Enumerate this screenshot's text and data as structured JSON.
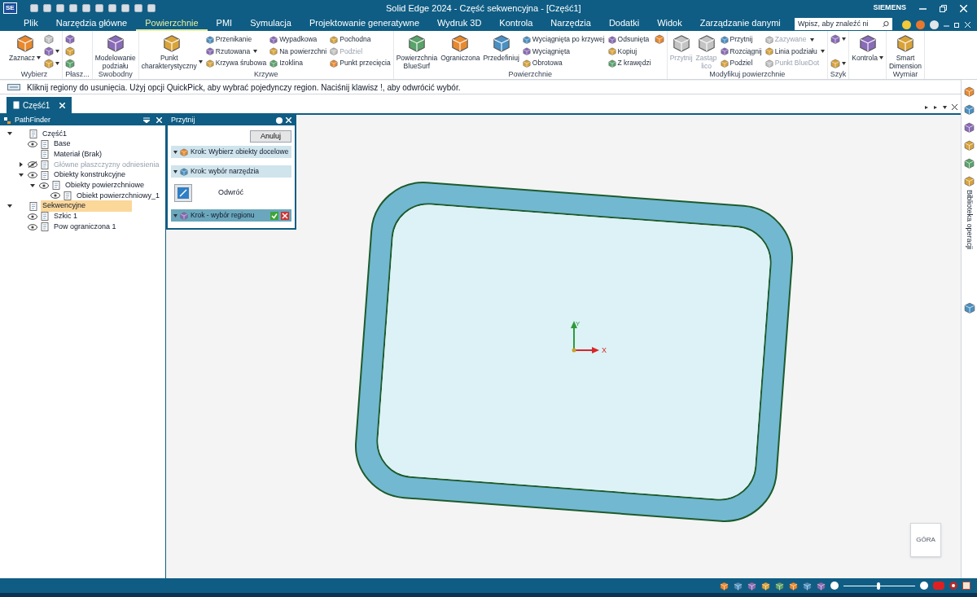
{
  "title_bar": {
    "logo": "SE",
    "title": "Solid Edge 2024 - Część sekwencyjna - [Część1]",
    "brand": "SIEMENS"
  },
  "menu_tabs": [
    {
      "label": "Plik",
      "selected": false
    },
    {
      "label": "Narzędzia główne",
      "selected": false
    },
    {
      "label": "Powierzchnie",
      "selected": true
    },
    {
      "label": "PMI",
      "selected": false
    },
    {
      "label": "Symulacja",
      "selected": false
    },
    {
      "label": "Projektowanie generatywne",
      "selected": false
    },
    {
      "label": "Wydruk 3D",
      "selected": false
    },
    {
      "label": "Kontrola",
      "selected": false
    },
    {
      "label": "Narzędzia",
      "selected": false
    },
    {
      "label": "Dodatki",
      "selected": false
    },
    {
      "label": "Widok",
      "selected": false
    },
    {
      "label": "Zarządzanie danymi",
      "selected": false
    }
  ],
  "search": {
    "placeholder": "Wpisz, aby znaleźć ni"
  },
  "ribbon": {
    "groups": [
      {
        "label": "Wybierz",
        "columns": [
          {
            "kind": "large",
            "items": [
              {
                "label": "Zaznacz",
                "disabled": false,
                "dropdown": true
              }
            ]
          },
          {
            "kind": "icons",
            "items": [
              {
                "disabled": true,
                "dropdown": false
              },
              {
                "disabled": false,
                "dropdown": true
              },
              {
                "disabled": false,
                "dropdown": true
              }
            ]
          }
        ]
      },
      {
        "label": "Płasz...",
        "columns": [
          {
            "kind": "icons",
            "items": [
              {
                "disabled": false,
                "dropdown": false
              },
              {
                "disabled": false,
                "dropdown": false
              },
              {
                "disabled": false,
                "dropdown": false
              }
            ]
          }
        ]
      },
      {
        "label": "Swobodny",
        "columns": [
          {
            "kind": "large",
            "items": [
              {
                "label": "Modelowanie\npodziału",
                "disabled": false,
                "dropdown": false
              }
            ]
          }
        ]
      },
      {
        "label": "Krzywe",
        "columns": [
          {
            "kind": "large",
            "items": [
              {
                "label": "Punkt\ncharakterystyczny",
                "disabled": false,
                "dropdown": true
              }
            ]
          },
          {
            "kind": "small",
            "items": [
              {
                "label": "Przenikanie",
                "disabled": false,
                "dropdown": false
              },
              {
                "label": "Rzutowana",
                "disabled": false,
                "dropdown": true
              },
              {
                "label": "Krzywa śrubowa",
                "disabled": false,
                "dropdown": false
              }
            ]
          },
          {
            "kind": "small",
            "items": [
              {
                "label": "Wypadkowa",
                "disabled": false,
                "dropdown": false
              },
              {
                "label": "Na powierzchni",
                "disabled": false,
                "dropdown": false
              },
              {
                "label": "Izoklina",
                "disabled": false,
                "dropdown": false
              }
            ]
          },
          {
            "kind": "small",
            "items": [
              {
                "label": "Pochodna",
                "disabled": false,
                "dropdown": false
              },
              {
                "label": "Podziel",
                "disabled": true,
                "dropdown": false
              },
              {
                "label": "Punkt przecięcia",
                "disabled": false,
                "dropdown": false
              }
            ]
          }
        ]
      },
      {
        "label": "Powierzchnie",
        "columns": [
          {
            "kind": "large",
            "items": [
              {
                "label": "Powierzchnia\nBlueSurf",
                "disabled": false,
                "dropdown": false
              },
              {
                "label": "Ograniczona",
                "disabled": false,
                "dropdown": false
              },
              {
                "label": "Przedefiniuj",
                "disabled": false,
                "dropdown": false
              }
            ]
          },
          {
            "kind": "small",
            "items": [
              {
                "label": "Wyciągnięta po krzywej",
                "disabled": false,
                "dropdown": false
              },
              {
                "label": "Wyciągnięta",
                "disabled": false,
                "dropdown": false
              },
              {
                "label": "Obrotowa",
                "disabled": false,
                "dropdown": false
              }
            ]
          },
          {
            "kind": "small",
            "items": [
              {
                "label": "Odsunięta",
                "disabled": false,
                "dropdown": false
              },
              {
                "label": "Kopiuj",
                "disabled": false,
                "dropdown": false
              },
              {
                "label": "Z krawędzi",
                "disabled": false,
                "dropdown": false
              }
            ]
          },
          {
            "kind": "icons",
            "items": [
              {
                "disabled": false,
                "dropdown": false
              }
            ]
          }
        ]
      },
      {
        "label": "Modyfikuj powierzchnie",
        "columns": [
          {
            "kind": "large",
            "items": [
              {
                "label": "Przytnij",
                "disabled": true,
                "dropdown": false
              },
              {
                "label": "Zastąp\nlico",
                "disabled": true,
                "dropdown": false
              }
            ]
          },
          {
            "kind": "small",
            "items": [
              {
                "label": "Przytnij",
                "disabled": false,
                "dropdown": false
              },
              {
                "label": "Rozciągnij",
                "disabled": false,
                "dropdown": false
              },
              {
                "label": "Podziel",
                "disabled": false,
                "dropdown": false
              }
            ]
          },
          {
            "kind": "small",
            "items": [
              {
                "label": "Zazywane",
                "disabled": true,
                "dropdown": true
              },
              {
                "label": "Linia podziału",
                "disabled": false,
                "dropdown": true
              },
              {
                "label": "Punkt BlueDot",
                "disabled": true,
                "dropdown": false
              }
            ]
          }
        ]
      },
      {
        "label": "Szyk",
        "columns": [
          {
            "kind": "icons",
            "items": [
              {
                "disabled": false,
                "dropdown": true
              },
              {
                "disabled": false,
                "dropdown": true
              }
            ]
          }
        ]
      },
      {
        "columns": [
          {
            "kind": "large",
            "items": [
              {
                "label": "Kontrola",
                "disabled": false,
                "dropdown": true
              }
            ]
          }
        ]
      },
      {
        "label": "Wymiar",
        "columns": [
          {
            "kind": "large",
            "items": [
              {
                "label": "Smart\nDimension",
                "disabled": false,
                "dropdown": false
              }
            ]
          }
        ]
      }
    ]
  },
  "prompt": "Kliknij regiony do usunięcia. Użyj opcji QuickPick, aby wybrać pojedynczy region. Naciśnij klawisz !, aby odwrócić wybór.",
  "document_tabs": [
    {
      "label": "Część1",
      "selected": true
    }
  ],
  "pathfinder": {
    "title": "PathFinder",
    "tree": [
      {
        "label": "Część1",
        "selected": false,
        "expanded": true,
        "children": [
          {
            "label": "Base",
            "visible": true,
            "selected": false
          },
          {
            "label": "Materiał (Brak)",
            "selected": false
          },
          {
            "label": "Główne płaszczyzny odniesienia",
            "visible": false,
            "selected": false,
            "expanded": false
          },
          {
            "label": "Obiekty konstrukcyjne",
            "visible": true,
            "selected": false,
            "expanded": true,
            "children": [
              {
                "label": "Obiekty powierzchniowe",
                "visible": true,
                "selected": false,
                "expanded": true,
                "children": [
                  {
                    "label": "Obiekt powierzchniowy_1",
                    "visible": true,
                    "selected": false
                  }
                ]
              }
            ]
          }
        ]
      },
      {
        "label": "Sekwencyjne",
        "selected": true,
        "expanded": true,
        "children": [
          {
            "label": "Szkic 1",
            "visible": true,
            "selected": false
          },
          {
            "label": "Pow ograniczona 1",
            "visible": true,
            "selected": false
          }
        ]
      }
    ]
  },
  "trim_panel": {
    "title": "Przytnij",
    "cancel": "Anuluj",
    "steps": [
      {
        "label": "Krok: Wybierz obiekty docelowe",
        "selected": false
      },
      {
        "label": "Krok: wybór narzędzia",
        "selected": false,
        "option": "Odwróć"
      },
      {
        "label": "Krok - wybór regionu",
        "selected": true
      }
    ]
  },
  "canvas": {
    "axis_x": "X",
    "axis_y": "Y",
    "view_cube": "GÓRA"
  },
  "right_toolbar": {
    "label": "Biblioteka operacji"
  },
  "status_bar": {
    "zoom_slider": {
      "level": 0.49
    }
  }
}
